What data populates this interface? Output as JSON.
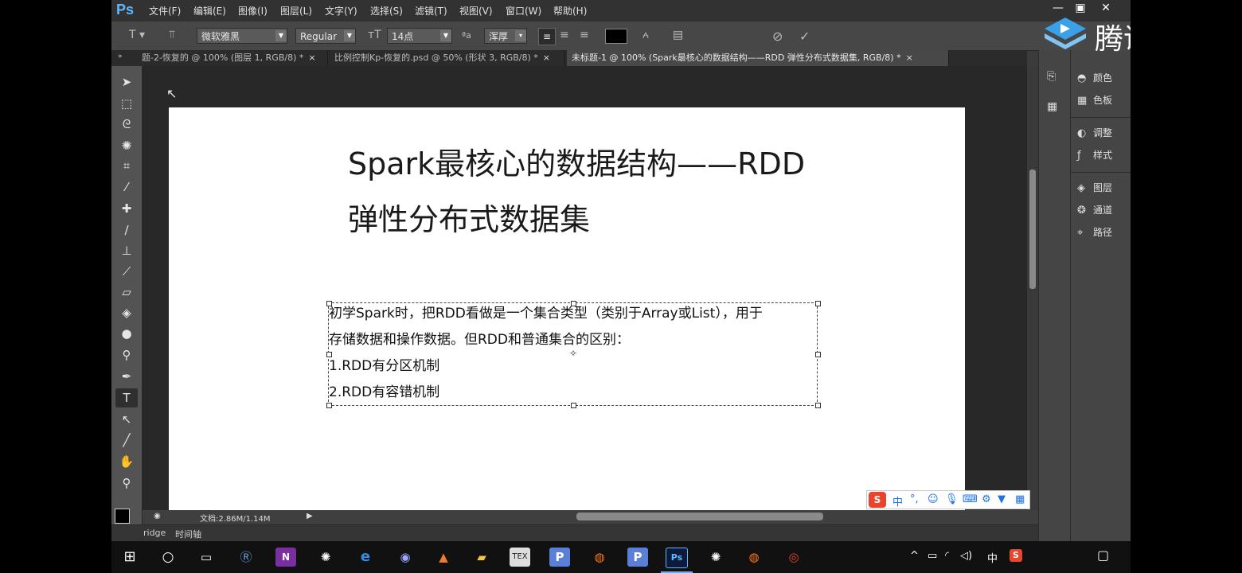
{
  "app": {
    "logo": "Ps",
    "menus": [
      "文件(F)",
      "编辑(E)",
      "图像(I)",
      "图层(L)",
      "文字(Y)",
      "选择(S)",
      "滤镜(T)",
      "视图(V)",
      "窗口(W)",
      "帮助(H)"
    ],
    "window_buttons": [
      "—",
      "▣",
      "✕"
    ]
  },
  "options": {
    "font_family": "微软雅黑",
    "font_style": "Regular",
    "font_size": "14点",
    "antialias_label": "ªa",
    "antialias": "浑厚",
    "color": "#000000"
  },
  "tabs": [
    {
      "label": "题-2-恢复的 @ 100% (图层 1, RGB/8) *",
      "active": false
    },
    {
      "label": "比例控制Kp-恢复的.psd @ 50% (形状 3, RGB/8) *",
      "active": false
    },
    {
      "label": "未标题-1 @ 100% (Spark最核心的数据结构——RDD 弹性分布式数据集, RGB/8) *",
      "active": true
    }
  ],
  "document": {
    "title_line1": "Spark最核心的数据结构——RDD",
    "title_line2": "弹性分布式数据集",
    "body_lines": [
      "初学Spark时，把RDD看做是一个集合类型（类别于Array或List），用于",
      "存储数据和操作数据。但RDD和普通集合的区别：",
      "1.RDD有分区机制",
      "2.RDD有容错机制"
    ]
  },
  "status": {
    "doc_info": "文档:2.86M/1.14M"
  },
  "bottom_tabs": [
    "ridge",
    "时间轴"
  ],
  "panels": [
    "颜色",
    "色板",
    "调整",
    "样式",
    "图层",
    "通道",
    "路径"
  ],
  "watermark": "腾讯课堂",
  "ime": {
    "mode": "中"
  },
  "tray": {
    "ime": "中"
  }
}
